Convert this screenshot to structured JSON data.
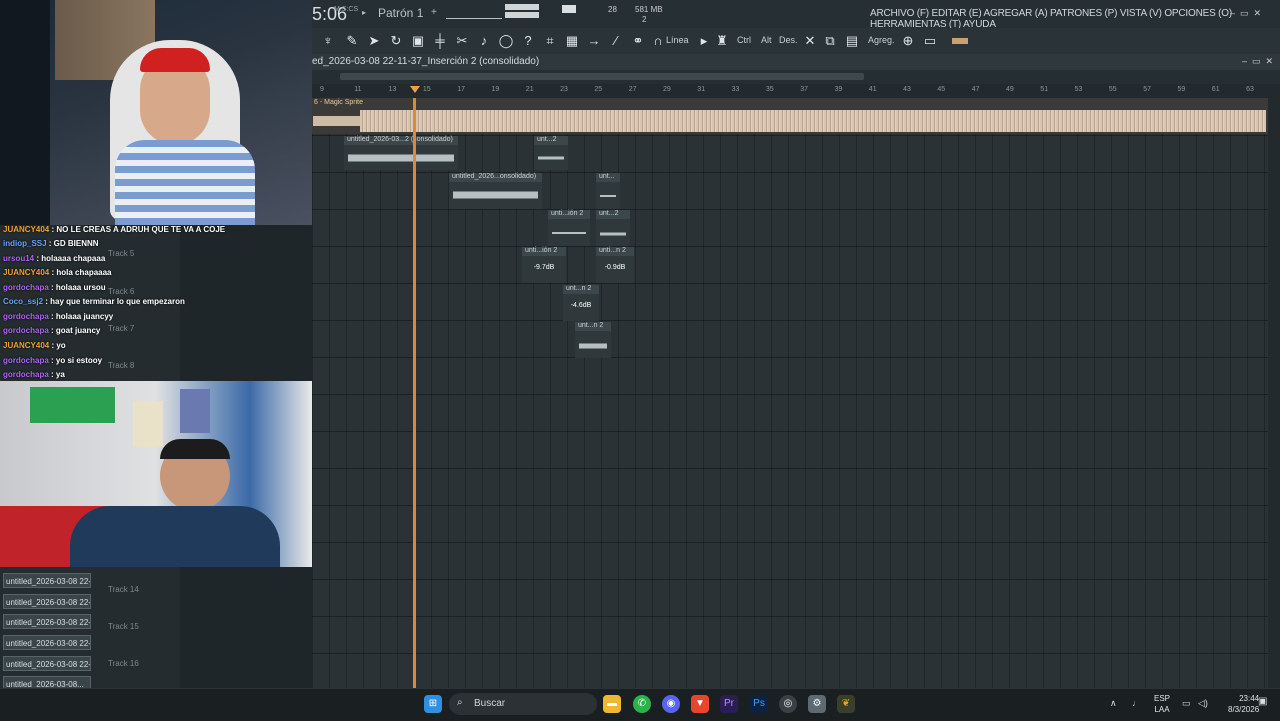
{
  "daw": {
    "time": "5:06",
    "time_sub": "M:S:CS",
    "pattern": "Patrón 1",
    "cpu": "28",
    "memory": "581 MB",
    "polyphony": "2",
    "menu": "ARCHIVO (F) EDITAR (E) AGREGAR (A) PATRONES (P) VISTA (V) OPCIONES (O) HERRAMIENTAS (T) AYUDA",
    "toolbar": {
      "line_label": "Línea",
      "ctrl_label": "Ctrl",
      "alt_label": "Alt",
      "des_label": "Des.",
      "agreg_label": "Agreg."
    },
    "playlist_title": "ed_2026-03-08 22-11-37_Inserción 2 (consolidado)",
    "ruler": [
      "9",
      "11",
      "13",
      "15",
      "17",
      "19",
      "21",
      "23",
      "25",
      "27",
      "29",
      "31",
      "33",
      "35",
      "37",
      "39",
      "41",
      "43",
      "45",
      "47",
      "49",
      "51",
      "53",
      "55",
      "57",
      "59",
      "61",
      "63"
    ],
    "magic_label": "6 - Magic Sprite",
    "clips": [
      {
        "label": "untitled_2026-03...2 (consolidado)",
        "db": ""
      },
      {
        "label": "unt...2",
        "db": ""
      },
      {
        "label": "untitled_2026...onsolidado)",
        "db": ""
      },
      {
        "label": "unt...",
        "db": ""
      },
      {
        "label": "unti...ión 2",
        "db": ""
      },
      {
        "label": "unt...2",
        "db": ""
      },
      {
        "label": "unti...ión 2",
        "db": "-9.7dB"
      },
      {
        "label": "unti...n 2",
        "db": "-0.9dB"
      },
      {
        "label": "unt...n 2",
        "db": "-4.6dB"
      },
      {
        "label": "unt...n 2",
        "db": ""
      }
    ]
  },
  "tracks": {
    "track5": "Track 5",
    "track6": "Track 6",
    "track7": "Track 7",
    "track8": "Track 8",
    "track14": "Track 14",
    "track15": "Track 15",
    "track16": "Track 16"
  },
  "chat": [
    {
      "user": "JUANCY404",
      "msg": ": NO LE CREAS A ADRUH QUE TE VA A COJE",
      "color": "#f0a030"
    },
    {
      "user": "indiop_SSJ",
      "msg": ": GD BIENNN",
      "color": "#6aa0ff"
    },
    {
      "user": "ursou14",
      "msg": ": holaaaa chapaaa",
      "color": "#b060f0"
    },
    {
      "user": "JUANCY404",
      "msg": ": hola chapaaaa",
      "color": "#f0a030"
    },
    {
      "user": "gordochapa",
      "msg": ": holaaa ursou",
      "color": "#b060f0"
    },
    {
      "user": "Coco_ssj2",
      "msg": ": hay que terminar lo que empezaron",
      "color": "#6aa0ff"
    },
    {
      "user": "gordochapa",
      "msg": ": holaaa juancyy",
      "color": "#b060f0"
    },
    {
      "user": "gordochapa",
      "msg": ": goat juancy",
      "color": "#b060f0"
    },
    {
      "user": "JUANCY404",
      "msg": ": yo",
      "color": "#f0a030"
    },
    {
      "user": "gordochapa",
      "msg": ": yo si estooy",
      "color": "#b060f0"
    },
    {
      "user": "gordochapa",
      "msg": ": ya",
      "color": "#b060f0"
    }
  ],
  "files": [
    "untitled_2026-03-08 22-...",
    "untitled_2026-03-08 22-...",
    "untitled_2026-03-08 22-...",
    "untitled_2026-03-08 22-...",
    "untitled_2026-03-08 22-...",
    "untitled_2026-03-08..."
  ],
  "taskbar": {
    "search": "Buscar",
    "lang1": "ESP",
    "lang2": "LAA",
    "time": "23:44",
    "date": "8/3/2026"
  }
}
